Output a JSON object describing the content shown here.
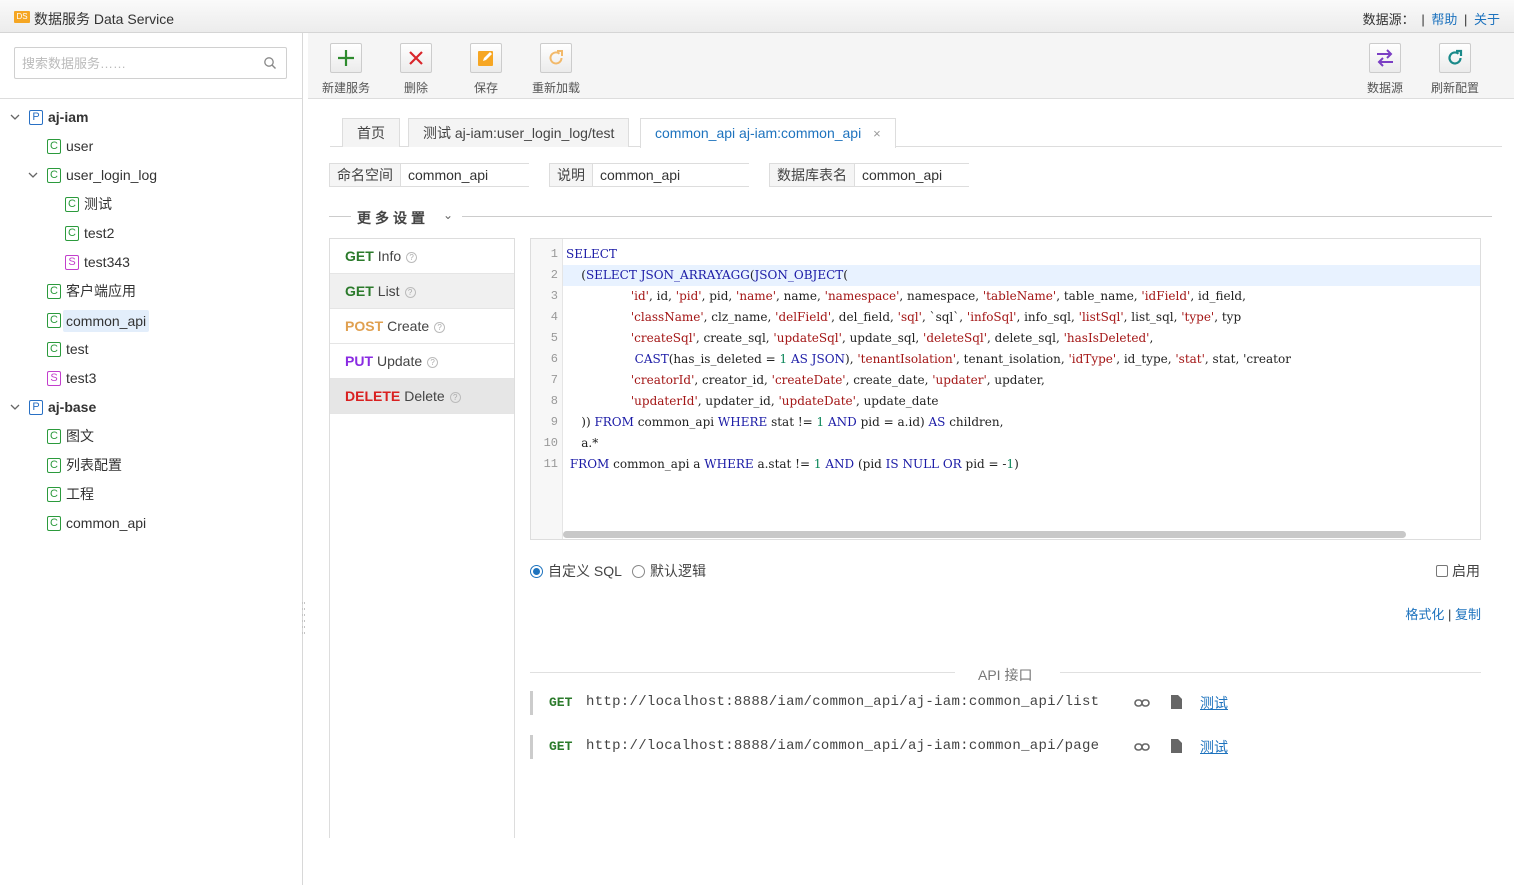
{
  "app": {
    "logo": "DS",
    "title": "数据服务 Data Service"
  },
  "top_links": {
    "datasource_label": "数据源：",
    "help": "帮助",
    "about": "关于"
  },
  "search": {
    "placeholder": "搜索数据服务……"
  },
  "tree": [
    {
      "label": "aj-iam",
      "badge": "P",
      "type": "project",
      "level": 0,
      "expanded": true
    },
    {
      "label": "user",
      "badge": "C",
      "type": "c",
      "level": 1
    },
    {
      "label": "user_login_log",
      "badge": "C",
      "type": "c",
      "level": 1,
      "expanded": true
    },
    {
      "label": "测试",
      "badge": "C",
      "type": "c",
      "level": 2
    },
    {
      "label": "test2",
      "badge": "C",
      "type": "c",
      "level": 2
    },
    {
      "label": "test343",
      "badge": "S",
      "type": "s",
      "level": 2
    },
    {
      "label": "客户端应用",
      "badge": "C",
      "type": "c",
      "level": 1
    },
    {
      "label": "common_api",
      "badge": "C",
      "type": "c",
      "level": 1,
      "selected": true
    },
    {
      "label": "test",
      "badge": "C",
      "type": "c",
      "level": 1
    },
    {
      "label": "test3",
      "badge": "S",
      "type": "s",
      "level": 1
    },
    {
      "label": "aj-base",
      "badge": "P",
      "type": "project",
      "level": 0,
      "expanded": true
    },
    {
      "label": "图文",
      "badge": "C",
      "type": "c",
      "level": 1
    },
    {
      "label": "列表配置",
      "badge": "C",
      "type": "c",
      "level": 1
    },
    {
      "label": "工程",
      "badge": "C",
      "type": "c",
      "level": 1
    },
    {
      "label": "common_api",
      "badge": "C",
      "type": "c",
      "level": 1
    }
  ],
  "toolbar": {
    "new_service": "新建服务",
    "delete": "删除",
    "save": "保存",
    "reload": "重新加载",
    "datasource": "数据源",
    "refresh_config": "刷新配置"
  },
  "tabs": [
    {
      "label": "首页"
    },
    {
      "label": "测试 aj-iam:user_login_log/test"
    },
    {
      "label": "common_api aj-iam:common_api",
      "active": true,
      "closable": "×"
    }
  ],
  "fields": {
    "namespace_label": "命名空间",
    "namespace_value": "common_api",
    "desc_label": "说明",
    "desc_value": "common_api",
    "table_label": "数据库表名",
    "table_value": "common_api"
  },
  "more_settings": "更多设置",
  "methods": [
    {
      "verb": "GET",
      "name": "Info",
      "color": "#2b7a2b"
    },
    {
      "verb": "GET",
      "name": "List",
      "color": "#2b7a2b"
    },
    {
      "verb": "POST",
      "name": "Create",
      "color": "#e0a050"
    },
    {
      "verb": "PUT",
      "name": "Update",
      "color": "#8a2be2"
    },
    {
      "verb": "DELETE",
      "name": "Delete",
      "color": "#d92020"
    }
  ],
  "code_lines": [
    "SELECT",
    "    (SELECT JSON_ARRAYAGG(JSON_OBJECT(",
    "                 'id', id, 'pid', pid, 'name', name, 'namespace', namespace, 'tableName', table_name, 'idField', id_field,",
    "                 'className', clz_name, 'delField', del_field, 'sql', `sql`, 'infoSql', info_sql, 'listSql', list_sql, 'type', typ",
    "                 'createSql', create_sql, 'updateSql', update_sql, 'deleteSql', delete_sql, 'hasIsDeleted',",
    "                  CAST(has_is_deleted = 1 AS JSON), 'tenantIsolation', tenant_isolation, 'idType', id_type, 'stat', stat, 'creator",
    "                 'creatorId', creator_id, 'createDate', create_date, 'updater', updater,",
    "                 'updaterId', updater_id, 'updateDate', update_date",
    "    )) FROM common_api WHERE stat != 1 AND pid = a.id) AS children,",
    "    a.*",
    " FROM common_api a WHERE a.stat != 1 AND (pid IS NULL OR pid = -1)"
  ],
  "options": {
    "custom_sql": "自定义 SQL",
    "default_logic": "默认逻辑",
    "enable": "启用"
  },
  "actions": {
    "format": "格式化",
    "copy": "复制"
  },
  "api": {
    "title": "API 接口",
    "rows": [
      {
        "verb": "GET",
        "url": "http://localhost:8888/iam/common_api/aj-iam:common_api/list",
        "test": "测试"
      },
      {
        "verb": "GET",
        "url": "http://localhost:8888/iam/common_api/aj-iam:common_api/page",
        "test": "测试"
      }
    ]
  }
}
